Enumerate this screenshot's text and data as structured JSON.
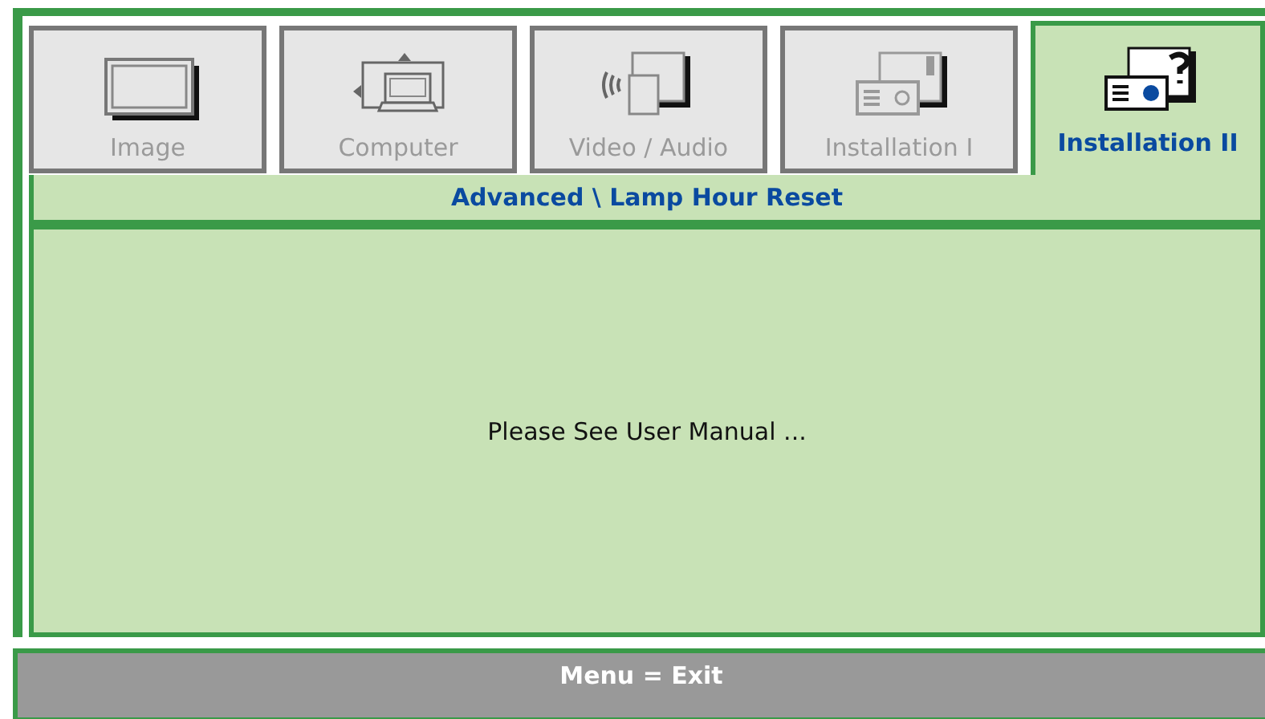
{
  "tabs": [
    {
      "label": "Image",
      "selected": false
    },
    {
      "label": "Computer",
      "selected": false
    },
    {
      "label": "Video / Audio",
      "selected": false
    },
    {
      "label": "Installation I",
      "selected": false
    },
    {
      "label": "Installation II",
      "selected": true
    }
  ],
  "breadcrumb": "Advanced \\ Lamp Hour Reset",
  "message": "Please See User Manual ...",
  "footer": "Menu = Exit"
}
